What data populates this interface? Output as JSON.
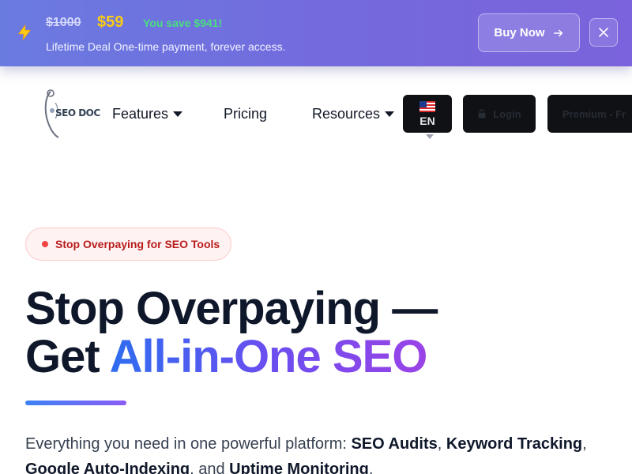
{
  "promo": {
    "old_price": "$1000",
    "new_price": "$59",
    "savings": "You save $941!",
    "tagline": "Lifetime Deal One-time payment, forever access.",
    "buy_label": "Buy Now",
    "icons": {
      "bolt": "lightning-bolt-icon",
      "arrow": "arrow-right-icon",
      "close": "close-icon"
    },
    "colors": {
      "new_price": "#facc15",
      "savings": "#4ade80"
    }
  },
  "nav": {
    "logo_text": "SEO DOC",
    "items": [
      {
        "label": "Features",
        "has_dropdown": true
      },
      {
        "label": "Pricing",
        "has_dropdown": false
      },
      {
        "label": "Resources",
        "has_dropdown": true
      }
    ],
    "language": {
      "code": "EN",
      "flag": "us-flag-icon"
    },
    "login_label": "Login",
    "premium_label": "Premium - Fr"
  },
  "hero": {
    "badge": "Stop Overpaying for SEO Tools",
    "headline_line1": "Stop Overpaying —",
    "headline_prefix": "Get ",
    "headline_highlight": "All-in-One SEO",
    "lead": {
      "intro": "Everything you need in one powerful platform: ",
      "feature1": "SEO Audits",
      "sep1": ", ",
      "feature2": "Keyword Tracking",
      "sep2": ",",
      "feature3": "Google Auto-Indexing",
      "sep3": ", and ",
      "feature4": "Uptime Monitoring",
      "end": "."
    },
    "colors": {
      "gradient_start": "#2f6df0",
      "gradient_end": "#9a43e6",
      "badge_text": "#b91c1c"
    }
  }
}
